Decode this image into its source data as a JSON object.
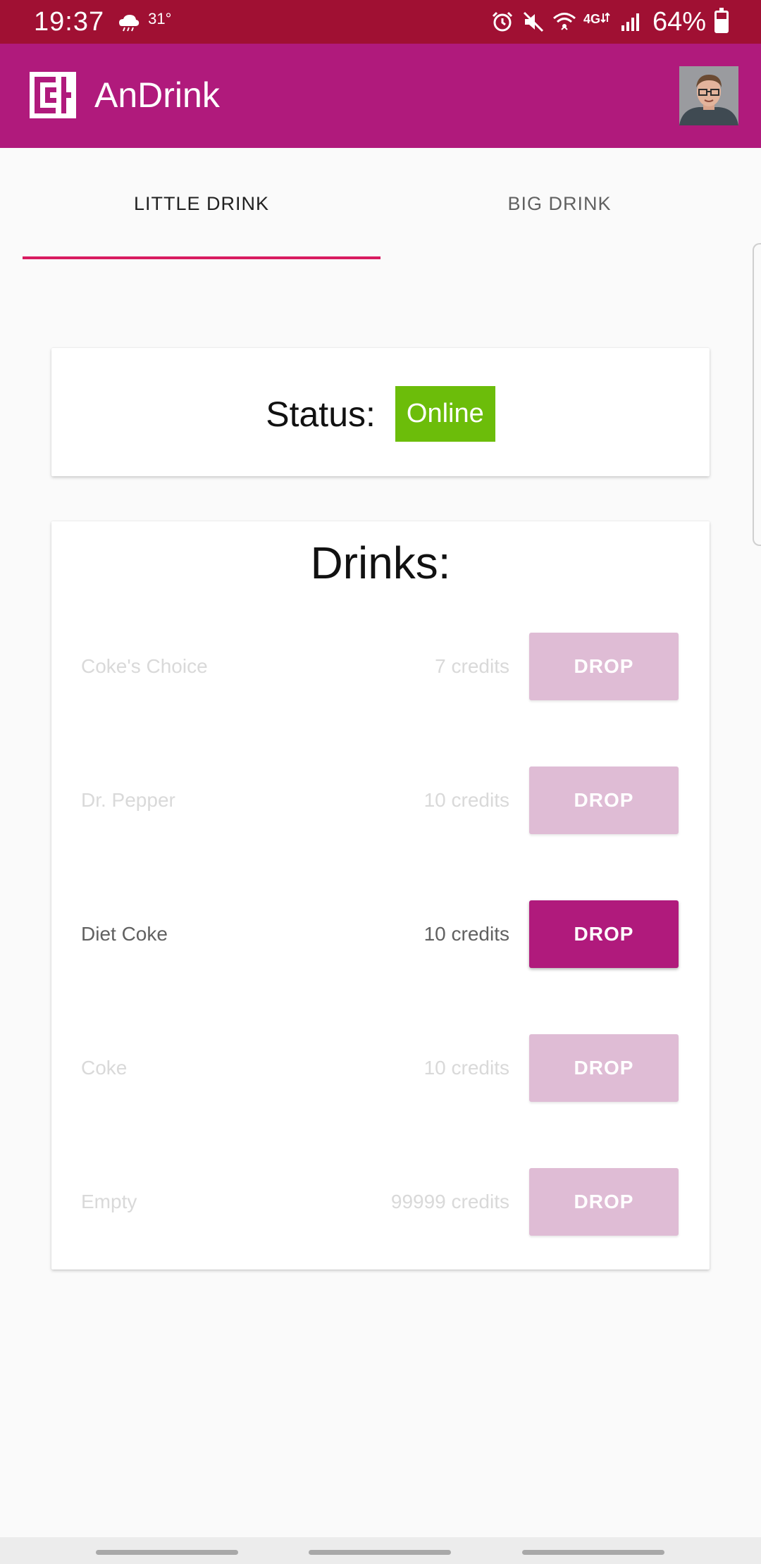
{
  "status_bar": {
    "time": "19:37",
    "temperature": "31°",
    "battery": "64%",
    "battery_level": 0.64,
    "icons": [
      "alarm-icon",
      "mute-icon",
      "wifi-icon",
      "lte-icon",
      "signal-icon",
      "battery-icon"
    ]
  },
  "app_bar": {
    "title": "AnDrink",
    "logo_icon": "csh-logo-icon",
    "color": "#b01a7c"
  },
  "tabs": [
    {
      "label": "LITTLE DRINK",
      "active": true
    },
    {
      "label": "BIG DRINK",
      "active": false
    }
  ],
  "status": {
    "label": "Status:",
    "value": "Online",
    "color": "#6cbd0a"
  },
  "drinks": {
    "title": "Drinks:",
    "items": [
      {
        "name": "Coke's Choice",
        "price": "7 credits",
        "button": "DROP",
        "enabled": false
      },
      {
        "name": "Dr. Pepper",
        "price": "10 credits",
        "button": "DROP",
        "enabled": false
      },
      {
        "name": "Diet Coke",
        "price": "10 credits",
        "button": "DROP",
        "enabled": true
      },
      {
        "name": "Coke",
        "price": "10 credits",
        "button": "DROP",
        "enabled": false
      },
      {
        "name": "Empty",
        "price": "99999 credits",
        "button": "DROP",
        "enabled": false
      }
    ]
  }
}
